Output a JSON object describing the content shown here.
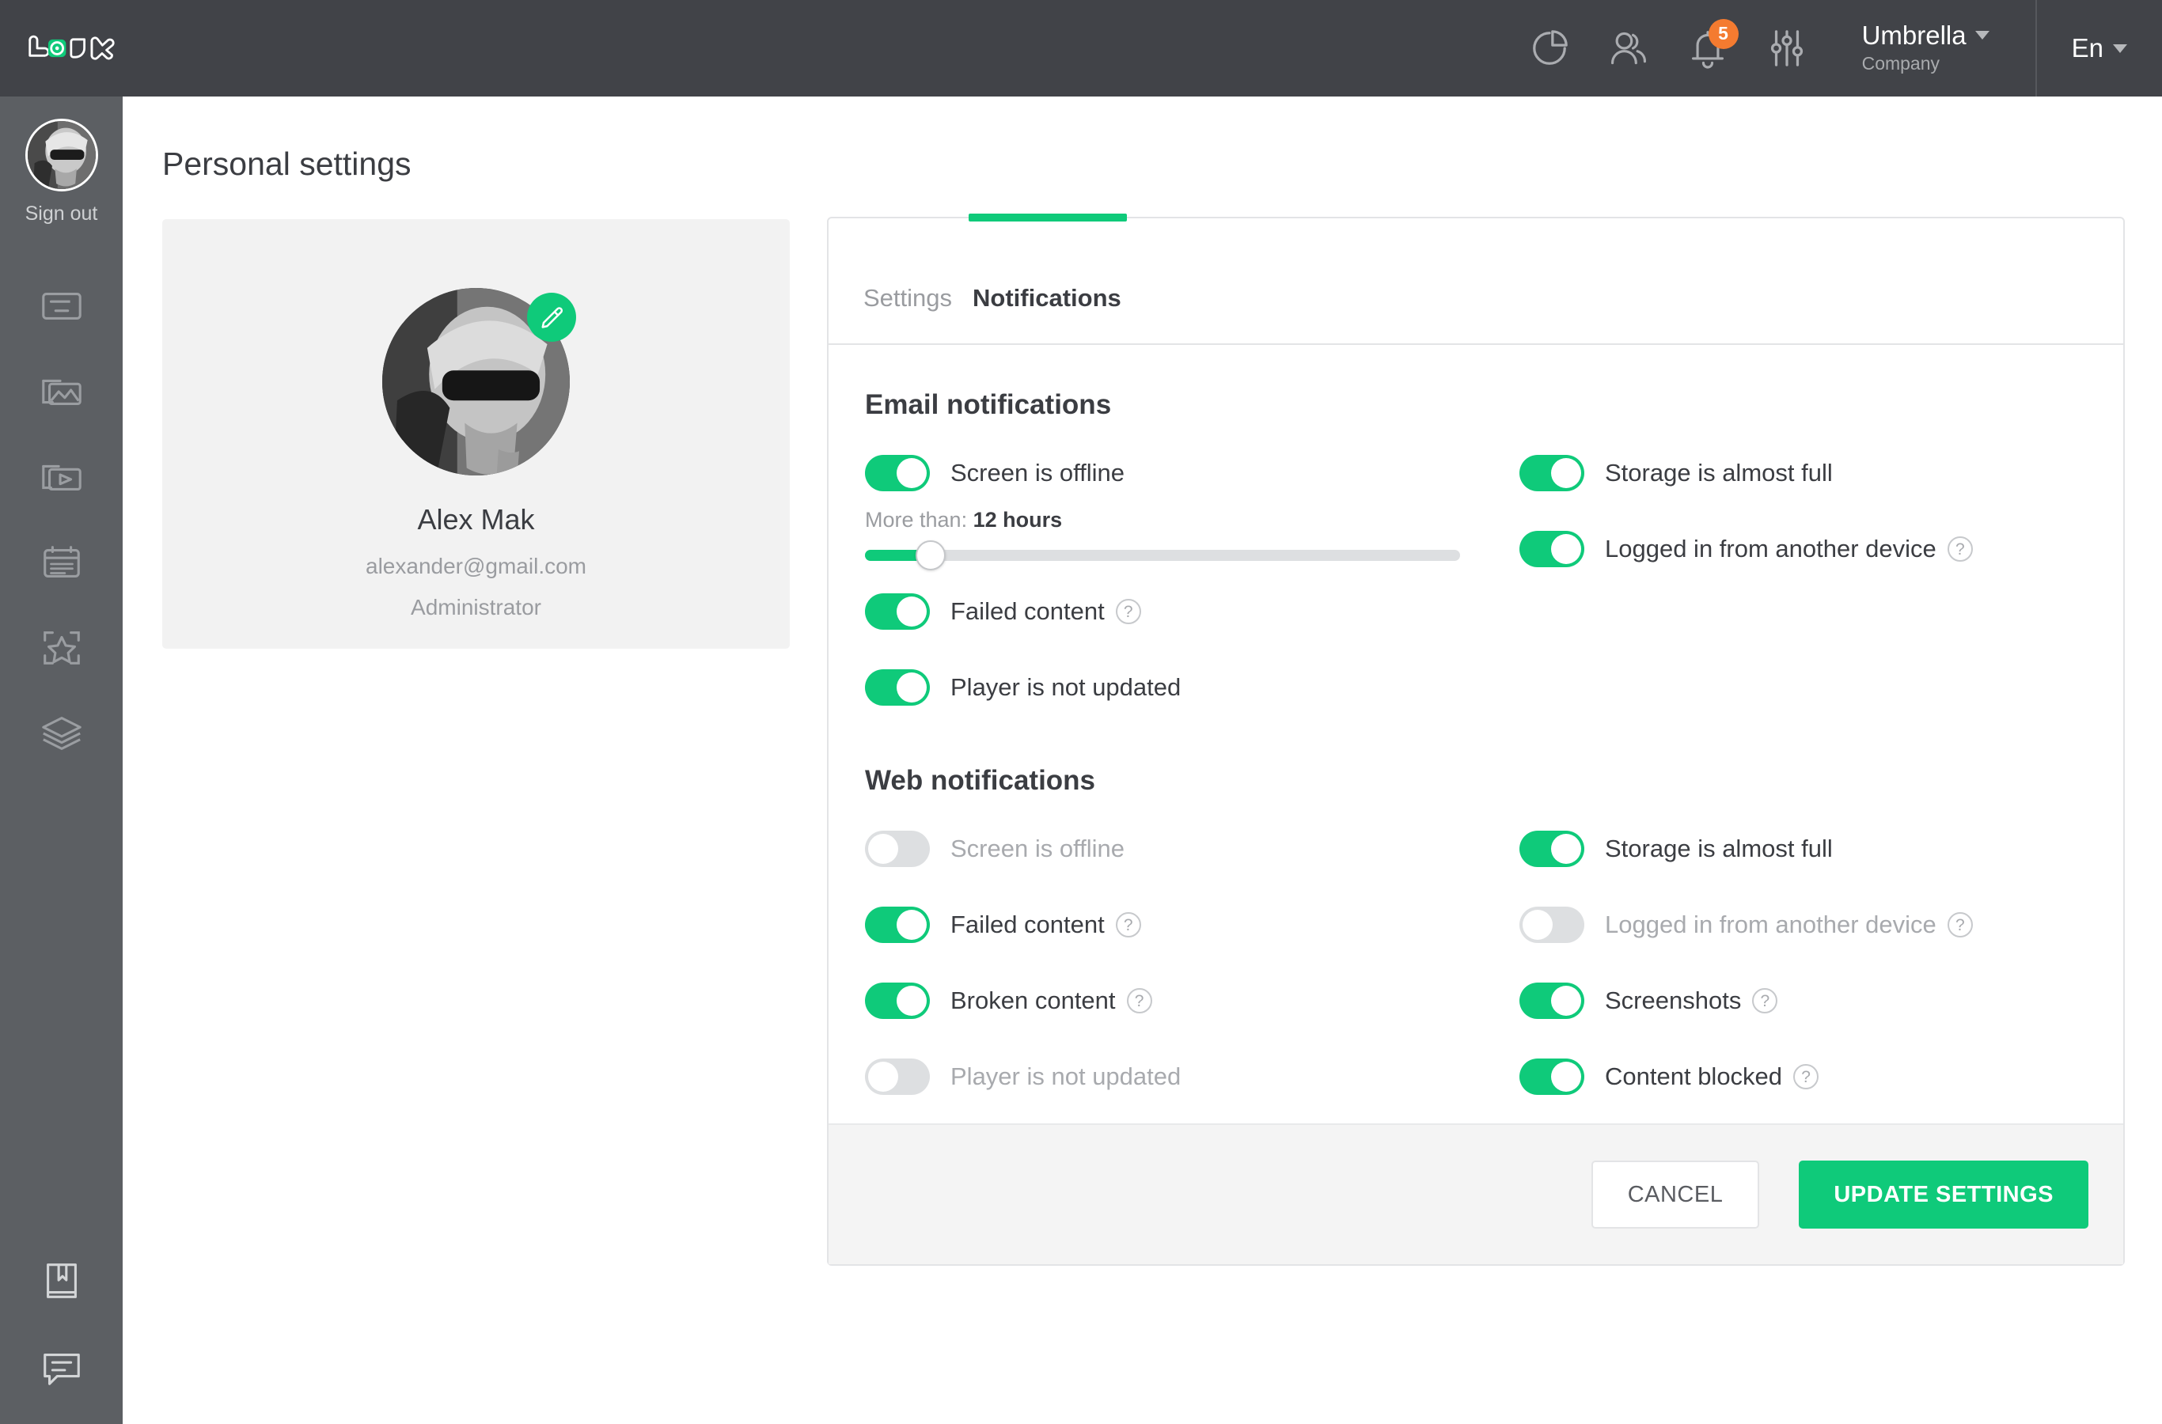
{
  "brand": {
    "name": "LOOK",
    "accent": "#0fca7a"
  },
  "header": {
    "icons": [
      {
        "name": "analytics-icon"
      },
      {
        "name": "users-icon"
      },
      {
        "name": "bell-icon",
        "badge": "5"
      },
      {
        "name": "sliders-icon"
      }
    ],
    "org": {
      "title": "Umbrella",
      "subtitle": "Company"
    },
    "language": {
      "value": "En"
    }
  },
  "sidebar": {
    "sign_out": "Sign out",
    "items": [
      {
        "icon": "screens-icon"
      },
      {
        "icon": "images-icon"
      },
      {
        "icon": "videos-icon"
      },
      {
        "icon": "playlist-icon"
      },
      {
        "icon": "highlight-icon"
      },
      {
        "icon": "layers-icon"
      }
    ],
    "bottom_items": [
      {
        "icon": "book-icon"
      },
      {
        "icon": "chat-icon"
      }
    ]
  },
  "page": {
    "title": "Personal settings"
  },
  "profile": {
    "name": "Alex Mak",
    "email": "alexander@gmail.com",
    "role": "Administrator",
    "edit_icon": "pencil-icon"
  },
  "tabs": [
    {
      "label": "Settings",
      "active": false
    },
    {
      "label": "Notifications",
      "active": true
    }
  ],
  "email_section": {
    "title": "Email notifications",
    "left": [
      {
        "label": "Screen is offline",
        "on": true,
        "help": false
      },
      {
        "label": "Failed content",
        "on": true,
        "help": true
      },
      {
        "label": "Player is not updated",
        "on": true,
        "help": false
      }
    ],
    "right": [
      {
        "label": "Storage is almost full",
        "on": true,
        "help": false
      },
      {
        "label": "Logged in from another device",
        "on": true,
        "help": true
      }
    ],
    "slider": {
      "caption_prefix": "More than:",
      "value": "12 hours",
      "percent": 11
    }
  },
  "web_section": {
    "title": "Web notifications",
    "left": [
      {
        "label": "Screen is offline",
        "on": false,
        "help": false
      },
      {
        "label": "Failed content",
        "on": true,
        "help": true
      },
      {
        "label": "Broken content",
        "on": true,
        "help": true
      },
      {
        "label": "Player is not updated",
        "on": false,
        "help": false
      }
    ],
    "right": [
      {
        "label": "Storage is almost full",
        "on": true,
        "help": false
      },
      {
        "label": "Logged in from another device",
        "on": false,
        "help": true
      },
      {
        "label": "Screenshots",
        "on": true,
        "help": true
      },
      {
        "label": "Content blocked",
        "on": true,
        "help": true
      }
    ]
  },
  "footer": {
    "cancel_label": "CANCEL",
    "submit_label": "UPDATE SETTINGS"
  },
  "help_glyph": "?"
}
